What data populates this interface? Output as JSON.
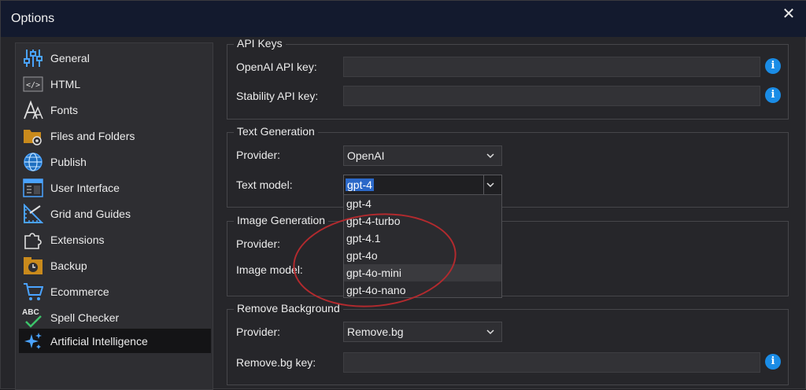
{
  "window": {
    "title": "Options",
    "close_symbol": "✕"
  },
  "sidebar": {
    "items": [
      {
        "label": "General",
        "icon": "sliders-icon"
      },
      {
        "label": "HTML",
        "icon": "code-icon"
      },
      {
        "label": "Fonts",
        "icon": "font-icon"
      },
      {
        "label": "Files and Folders",
        "icon": "folder-gear-icon"
      },
      {
        "label": "Publish",
        "icon": "globe-icon"
      },
      {
        "label": "User Interface",
        "icon": "window-icon"
      },
      {
        "label": "Grid and Guides",
        "icon": "ruler-icon"
      },
      {
        "label": "Extensions",
        "icon": "puzzle-icon"
      },
      {
        "label": "Backup",
        "icon": "backup-icon"
      },
      {
        "label": "Ecommerce",
        "icon": "cart-icon"
      },
      {
        "label": "Spell Checker",
        "icon": "spellcheck-icon",
        "icon_text": "ABC"
      },
      {
        "label": "Artificial Intelligence",
        "icon": "sparkles-icon",
        "selected": true
      }
    ]
  },
  "api_keys": {
    "title": "API Keys",
    "openai_label": "OpenAI API key:",
    "openai_value": "",
    "stability_label": "Stability API key:",
    "stability_value": ""
  },
  "text_generation": {
    "title": "Text Generation",
    "provider_label": "Provider:",
    "provider_value": "OpenAI",
    "model_label": "Text model:",
    "model_value": "gpt-4",
    "model_options": [
      "gpt-4",
      "gpt-4-turbo",
      "gpt-4.1",
      "gpt-4o",
      "gpt-4o-mini",
      "gpt-4o-nano"
    ],
    "hovered_option": "gpt-4o-mini"
  },
  "image_generation": {
    "title": "Image Generation",
    "provider_label": "Provider:",
    "model_label": "Image model:"
  },
  "remove_background": {
    "title": "Remove Background",
    "provider_label": "Provider:",
    "provider_value": "Remove.bg",
    "key_label": "Remove.bg key:",
    "key_value": ""
  },
  "info_symbol": "i",
  "colors": {
    "accent": "#1a8ce6",
    "selection": "#2b68c8",
    "annotation": "#b22a2e",
    "titlebar": "#131a2e"
  }
}
